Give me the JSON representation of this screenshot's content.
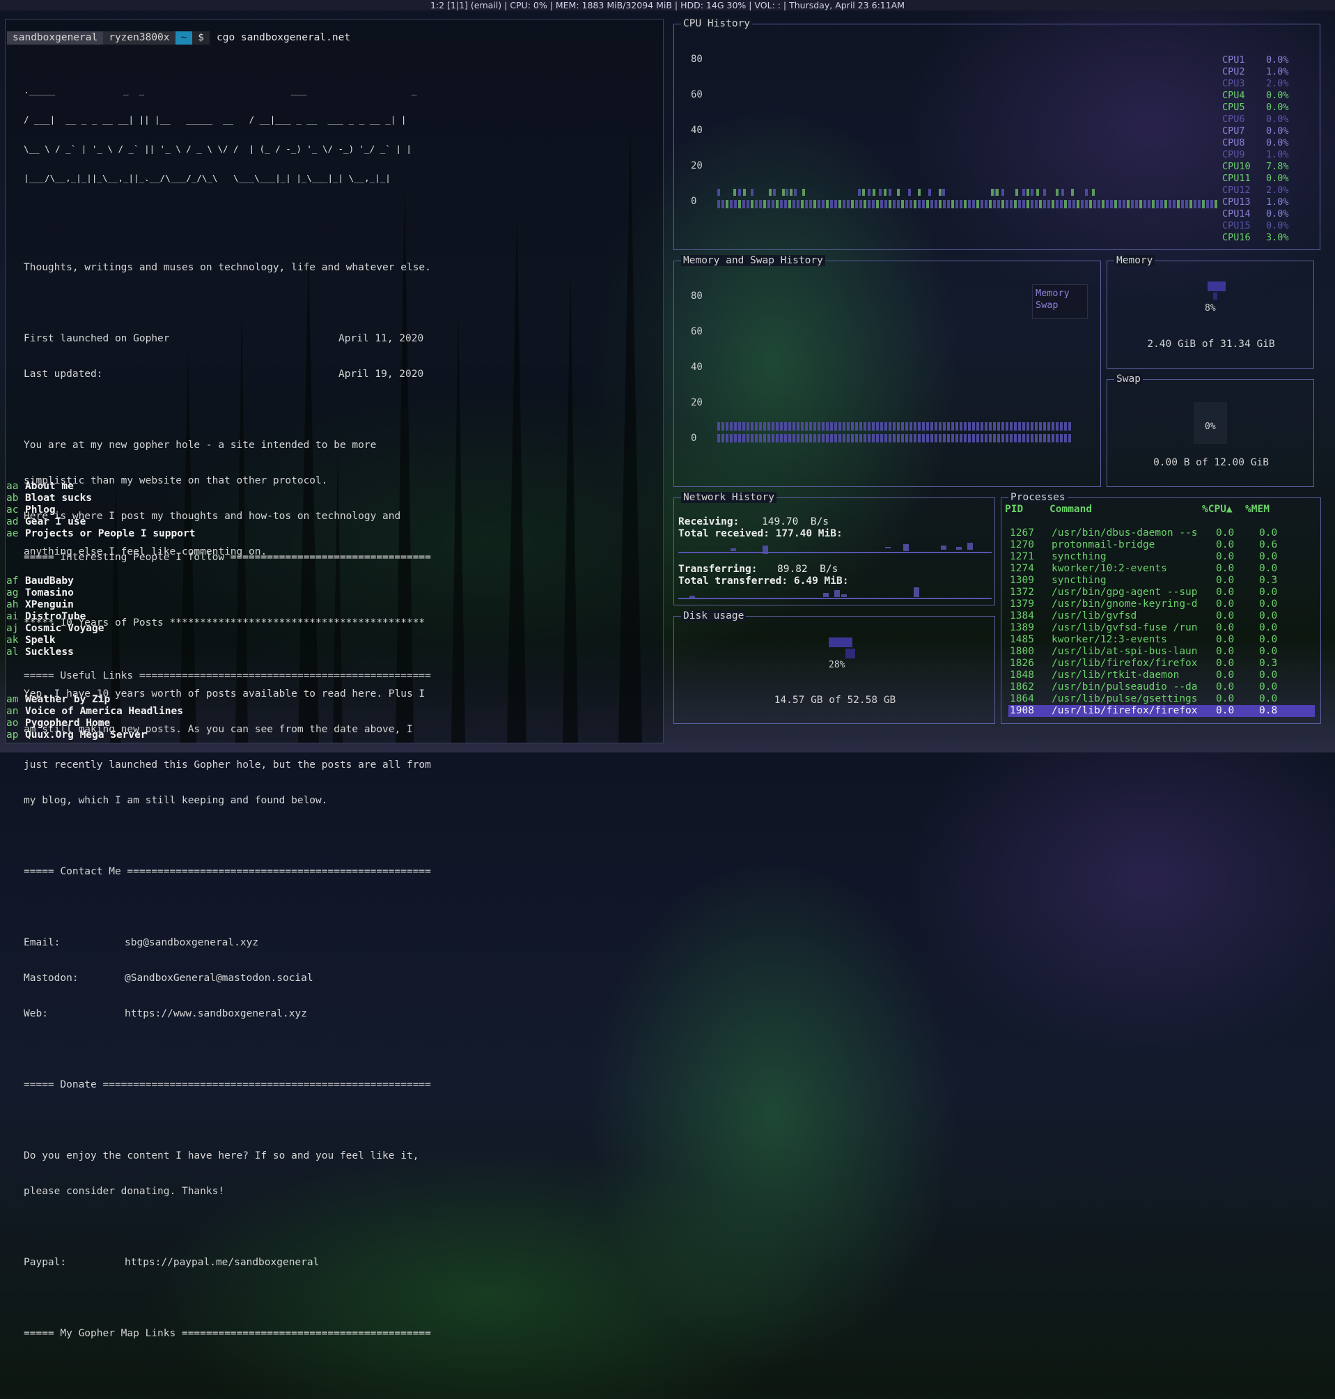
{
  "statusbar": {
    "text": "1:2 [1|1] (email) | CPU: 0% | MEM: 1883 MiB/32094 MiB | HDD: 14G 30% | VOL: : | Thursday, April 23  6:11AM"
  },
  "prompt": {
    "user": "sandboxgeneral",
    "host": "ryzen3800x",
    "dir": "~",
    "symbol": "$",
    "command": "cgo sandboxgeneral.net"
  },
  "gopher": {
    "ascii": [
      "._____             _  _                            ___                    _ ",
      "/ ___|  __ _ _ __ __| || |__   _____  __   / __|___ _ __  ___ _ _ __ _| |",
      "\\__ \\ / _` | '_ \\ / _` || '_ \\ / _ \\ \\/ /  | (_ / -_) '_ \\/ -_) '_/ _` | |",
      "|___/\\__,_|_||_\\__,_||_.__/\\___/_/\\_\\   \\___\\___|_| |_\\___|_| \\__,_|_|"
    ],
    "tagline": "Thoughts, writings and muses on technology, life and whatever else.",
    "launched_label": "First launched on Gopher",
    "launched_date": "April 11, 2020",
    "updated_label": "Last updated:",
    "updated_date": "April 19, 2020",
    "intro": [
      "You are at my new gopher hole - a site intended to be more",
      "simplistic than my website on that other protocol.",
      "Here is where I post my thoughts and how-tos on technology and",
      "anything else I feel like commenting on."
    ],
    "posts_heading": "***** 10 Years of Posts ******************************************",
    "posts_text": [
      "Yep. I have 10 years worth of posts available to read here. Plus I",
      "am still making new posts. As you can see from the date above, I",
      "just recently launched this Gopher hole, but the posts are all from",
      "my blog, which I am still keeping and found below."
    ],
    "contact_heading": "===== Contact Me ==================================================",
    "contact": [
      {
        "label": "Email:",
        "value": "sbg@sandboxgeneral.xyz"
      },
      {
        "label": "Mastodon:",
        "value": "@SandboxGeneral@mastodon.social"
      },
      {
        "label": "Web:",
        "value": "https://www.sandboxgeneral.xyz"
      }
    ],
    "donate_heading": "===== Donate ======================================================",
    "donate_text": [
      "Do you enjoy the content I have here? If so and you feel like it,",
      "please consider donating. Thanks!"
    ],
    "paypal_label": "Paypal:",
    "paypal_value": "https://paypal.me/sandboxgeneral",
    "maplinks_heading": "===== My Gopher Map Links =========================================",
    "maplinks": [
      {
        "key": "aa",
        "text": "About me"
      },
      {
        "key": "ab",
        "text": "Bloat sucks"
      },
      {
        "key": "ac",
        "text": "Phlog"
      },
      {
        "key": "ad",
        "text": "Gear I use"
      },
      {
        "key": "ae",
        "text": "Projects or People I support"
      }
    ],
    "people_heading": "===== Interesting People I follow =================================",
    "people": [
      {
        "key": "af",
        "text": "BaudBaby"
      },
      {
        "key": "ag",
        "text": "Tomasino"
      },
      {
        "key": "ah",
        "text": "XPenguin"
      },
      {
        "key": "ai",
        "text": "DistroTube"
      },
      {
        "key": "aj",
        "text": "Cosmic Voyage"
      },
      {
        "key": "ak",
        "text": "Spelk"
      },
      {
        "key": "al",
        "text": "Suckless"
      }
    ],
    "useful_heading": "===== Useful Links ================================================",
    "useful": [
      {
        "key": "am",
        "text": "Weather by Zip"
      },
      {
        "key": "an",
        "text": "Voice of America Headlines"
      },
      {
        "key": "ao",
        "text": "Pygopherd Home"
      },
      {
        "key": "ap",
        "text": "Quux.Org Mega Server"
      }
    ]
  },
  "gotop": {
    "cpu": {
      "title": "CPU History",
      "yticks": [
        "80",
        "60",
        "40",
        "20",
        "0"
      ],
      "cores": [
        {
          "name": "CPU1",
          "value": "0.0%",
          "color": "#8a82d8"
        },
        {
          "name": "CPU2",
          "value": "1.0%",
          "color": "#8a82d8"
        },
        {
          "name": "CPU3",
          "value": "2.0%",
          "color": "#5a55a8"
        },
        {
          "name": "CPU4",
          "value": "0.0%",
          "color": "#6ad06a"
        },
        {
          "name": "CPU5",
          "value": "0.0%",
          "color": "#6ad06a"
        },
        {
          "name": "CPU6",
          "value": "0.0%",
          "color": "#5a55a8"
        },
        {
          "name": "CPU7",
          "value": "0.0%",
          "color": "#8a82d8"
        },
        {
          "name": "CPU8",
          "value": "0.0%",
          "color": "#8a82d8"
        },
        {
          "name": "CPU9",
          "value": "1.0%",
          "color": "#5a55a8"
        },
        {
          "name": "CPU10",
          "value": "7.8%",
          "color": "#6ad06a"
        },
        {
          "name": "CPU11",
          "value": "0.0%",
          "color": "#6ad06a"
        },
        {
          "name": "CPU12",
          "value": "2.0%",
          "color": "#5a55a8"
        },
        {
          "name": "CPU13",
          "value": "1.0%",
          "color": "#8a82d8"
        },
        {
          "name": "CPU14",
          "value": "0.0%",
          "color": "#8a82d8"
        },
        {
          "name": "CPU15",
          "value": "0.0%",
          "color": "#5a55a8"
        },
        {
          "name": "CPU16",
          "value": "3.0%",
          "color": "#6ad06a"
        }
      ]
    },
    "memswap": {
      "title": "Memory and Swap History",
      "yticks": [
        "80",
        "60",
        "40",
        "20",
        "0"
      ],
      "legend": [
        "Memory",
        "Swap"
      ]
    },
    "memory": {
      "title": "Memory",
      "percent": "8%",
      "detail": "2.40 GiB of 31.34 GiB"
    },
    "swap": {
      "title": "Swap",
      "percent": "0%",
      "detail": "0.00 B of 12.00 GiB"
    },
    "network": {
      "title": "Network History",
      "receiving_label": "Receiving:",
      "receiving_value": "149.70  B/s",
      "total_received_label": "Total received:",
      "total_received_value": "177.40 MiB:",
      "transferring_label": "Transferring:",
      "transferring_value": "89.82  B/s",
      "total_transferred_label": "Total transferred:",
      "total_transferred_value": "6.49 MiB:"
    },
    "disk": {
      "title": "Disk usage",
      "percent": "28%",
      "detail": "14.57 GB of 52.58 GB"
    },
    "processes": {
      "title": "Processes",
      "headers": [
        "PID",
        "Command",
        "%CPU▲",
        "%MEM"
      ],
      "rows": [
        {
          "pid": "1267",
          "cmd": "/usr/bin/dbus-daemon --s",
          "cpu": "0.0",
          "mem": "0.0"
        },
        {
          "pid": "1270",
          "cmd": "protonmail-bridge",
          "cpu": "0.0",
          "mem": "0.6"
        },
        {
          "pid": "1271",
          "cmd": "syncthing",
          "cpu": "0.0",
          "mem": "0.0"
        },
        {
          "pid": "1274",
          "cmd": "kworker/10:2-events",
          "cpu": "0.0",
          "mem": "0.0"
        },
        {
          "pid": "1309",
          "cmd": "syncthing",
          "cpu": "0.0",
          "mem": "0.3"
        },
        {
          "pid": "1372",
          "cmd": "/usr/bin/gpg-agent --sup",
          "cpu": "0.0",
          "mem": "0.0"
        },
        {
          "pid": "1379",
          "cmd": "/usr/bin/gnome-keyring-d",
          "cpu": "0.0",
          "mem": "0.0"
        },
        {
          "pid": "1384",
          "cmd": "/usr/lib/gvfsd",
          "cpu": "0.0",
          "mem": "0.0"
        },
        {
          "pid": "1389",
          "cmd": "/usr/lib/gvfsd-fuse /run",
          "cpu": "0.0",
          "mem": "0.0"
        },
        {
          "pid": "1485",
          "cmd": "kworker/12:3-events",
          "cpu": "0.0",
          "mem": "0.0"
        },
        {
          "pid": "1800",
          "cmd": "/usr/lib/at-spi-bus-laun",
          "cpu": "0.0",
          "mem": "0.0"
        },
        {
          "pid": "1826",
          "cmd": "/usr/lib/firefox/firefox",
          "cpu": "0.0",
          "mem": "0.3"
        },
        {
          "pid": "1848",
          "cmd": "/usr/lib/rtkit-daemon",
          "cpu": "0.0",
          "mem": "0.0"
        },
        {
          "pid": "1862",
          "cmd": "/usr/bin/pulseaudio --da",
          "cpu": "0.0",
          "mem": "0.0"
        },
        {
          "pid": "1864",
          "cmd": "/usr/lib/pulse/gsettings",
          "cpu": "0.0",
          "mem": "0.0"
        },
        {
          "pid": "1908",
          "cmd": "/usr/lib/firefox/firefox",
          "cpu": "0.0",
          "mem": "0.8"
        }
      ],
      "selected_pid": "1908"
    }
  }
}
